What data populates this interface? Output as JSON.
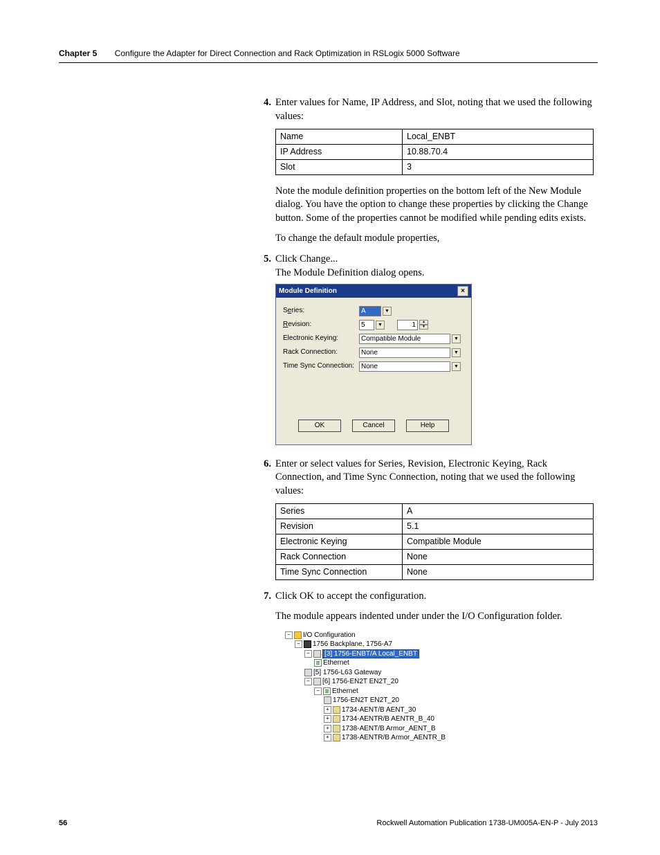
{
  "header": {
    "chapter": "Chapter 5",
    "title": "Configure the Adapter for Direct Connection and Rack Optimization in RSLogix 5000 Software"
  },
  "steps": {
    "s4_num": "4.",
    "s4_text": "Enter values for Name, IP Address, and Slot, noting that we used the following values:",
    "s5_num": "5.",
    "s5_text": "Click Change...",
    "s5_sub": "The Module Definition dialog opens.",
    "s6_num": "6.",
    "s6_text": "Enter or select values for Series, Revision, Electronic Keying, Rack Connection, and Time Sync Connection, noting that we used the following values:",
    "s7_num": "7.",
    "s7_text": "Click OK to accept the configuration."
  },
  "table1": {
    "r1c1": "Name",
    "r1c2": "Local_ENBT",
    "r2c1": "IP Address",
    "r2c2": "10.88.70.4",
    "r3c1": "Slot",
    "r3c2": "3"
  },
  "note1": "Note the module definition properties on the bottom left of the New Module dialog. You have the option to change these properties by clicking the Change button. Some of the properties cannot be modified while pending edits exists.",
  "note2": "To change the default module properties,",
  "dialog": {
    "title": "Module Definition",
    "labels": {
      "series_pre": "S",
      "series_ul": "e",
      "series_post": "ries:",
      "revision_ul": "R",
      "revision_post": "evision:",
      "keying": "Electronic Keying:",
      "rack": "Rack Connection:",
      "timesync": "Time Sync Connection:"
    },
    "values": {
      "series": "A",
      "revision_major": "5",
      "revision_minor": "1",
      "keying": "Compatible Module",
      "rack": "None",
      "timesync": "None"
    },
    "buttons": {
      "ok": "OK",
      "cancel": "Cancel",
      "help": "Help"
    }
  },
  "table2": {
    "r1c1": "Series",
    "r1c2": "A",
    "r2c1": "Revision",
    "r2c2": "5.1",
    "r3c1": "Electronic Keying",
    "r3c2": "Compatible Module",
    "r4c1": "Rack Connection",
    "r4c2": "None",
    "r5c1": "Time Sync Connection",
    "r5c2": "None"
  },
  "post7": "The module appears indented under under the I/O Configuration folder.",
  "tree": {
    "n0": "I/O Configuration",
    "n1": "1756 Backplane, 1756-A7",
    "n2": "[3] 1756-ENBT/A Local_ENBT",
    "n3": "Ethernet",
    "n4": "[5] 1756-L63 Gateway",
    "n5": "[6] 1756-EN2T EN2T_20",
    "n6": "Ethernet",
    "n7": "1756-EN2T EN2T_20",
    "n8": "1734-AENT/B AENT_30",
    "n9": "1734-AENTR/B AENTR_B_40",
    "n10": "1738-AENT/B Armor_AENT_B",
    "n11": "1738-AENTR/B Armor_AENTR_B"
  },
  "footer": {
    "page": "56",
    "pub": "Rockwell Automation Publication 1738-UM005A-EN-P - July 2013"
  },
  "chart_data": {
    "type": "table",
    "tables": [
      {
        "rows": [
          [
            "Name",
            "Local_ENBT"
          ],
          [
            "IP Address",
            "10.88.70.4"
          ],
          [
            "Slot",
            "3"
          ]
        ]
      },
      {
        "rows": [
          [
            "Series",
            "A"
          ],
          [
            "Revision",
            "5.1"
          ],
          [
            "Electronic Keying",
            "Compatible Module"
          ],
          [
            "Rack Connection",
            "None"
          ],
          [
            "Time Sync Connection",
            "None"
          ]
        ]
      }
    ]
  }
}
